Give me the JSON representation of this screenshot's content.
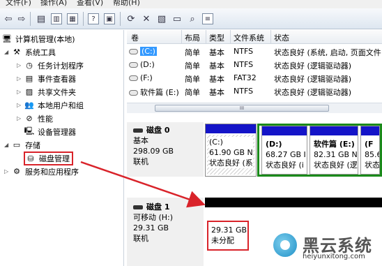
{
  "menu": {
    "file": "文件(F)",
    "action": "操作(A)",
    "view": "查看(V)",
    "help": "帮助(H)"
  },
  "tree": {
    "root": "计算机管理(本地)",
    "system_tools": "系统工具",
    "task_scheduler": "任务计划程序",
    "event_viewer": "事件查看器",
    "shared_folders": "共享文件夹",
    "local_users": "本地用户和组",
    "performance": "性能",
    "device_manager": "设备管理器",
    "storage": "存储",
    "disk_management": "磁盘管理",
    "services": "服务和应用程序"
  },
  "volume_table": {
    "headers": [
      "卷",
      "布局",
      "类型",
      "文件系统",
      "状态"
    ],
    "rows": [
      {
        "volume": "(C:)",
        "layout": "简单",
        "type": "基本",
        "fs": "NTFS",
        "status": "状态良好 (系统, 启动, 页面文件"
      },
      {
        "volume": "(D:)",
        "layout": "简单",
        "type": "基本",
        "fs": "NTFS",
        "status": "状态良好 (逻辑驱动器)"
      },
      {
        "volume": "(F:)",
        "layout": "简单",
        "type": "基本",
        "fs": "FAT32",
        "status": "状态良好 (逻辑驱动器)"
      },
      {
        "volume": "软件篇 (E:)",
        "layout": "简单",
        "type": "基本",
        "fs": "NTFS",
        "status": "状态良好 (逻辑驱动器)"
      }
    ],
    "scroll_glyph": "III"
  },
  "disk0": {
    "name": "磁盘 0",
    "kind": "基本",
    "size": "298.09 GB",
    "state": "联机",
    "partitions": [
      {
        "label": "(C:)",
        "size": "61.90 GB N",
        "status": "状态良好 (系"
      },
      {
        "label": "(D:)",
        "size": "68.27 GB I",
        "status": "状态良好 (i"
      },
      {
        "label": "软件篇 (E:)",
        "size": "82.31 GB N",
        "status": "状态良好 (逻"
      },
      {
        "label": "(F",
        "size": "85.6",
        "status": "状态"
      }
    ]
  },
  "disk1": {
    "name": "磁盘 1",
    "kind": "可移动 (H:)",
    "size": "29.31 GB",
    "state": "联机",
    "partition": {
      "size": "29.31 GB",
      "status": "未分配"
    }
  },
  "watermark": {
    "title": "黑云系统",
    "url": "heiyunxitong.com"
  },
  "colors": {
    "primary_partition": "#1414c8",
    "unallocated": "#000000",
    "highlight": "#d9232a",
    "selection": "#3399ff"
  }
}
